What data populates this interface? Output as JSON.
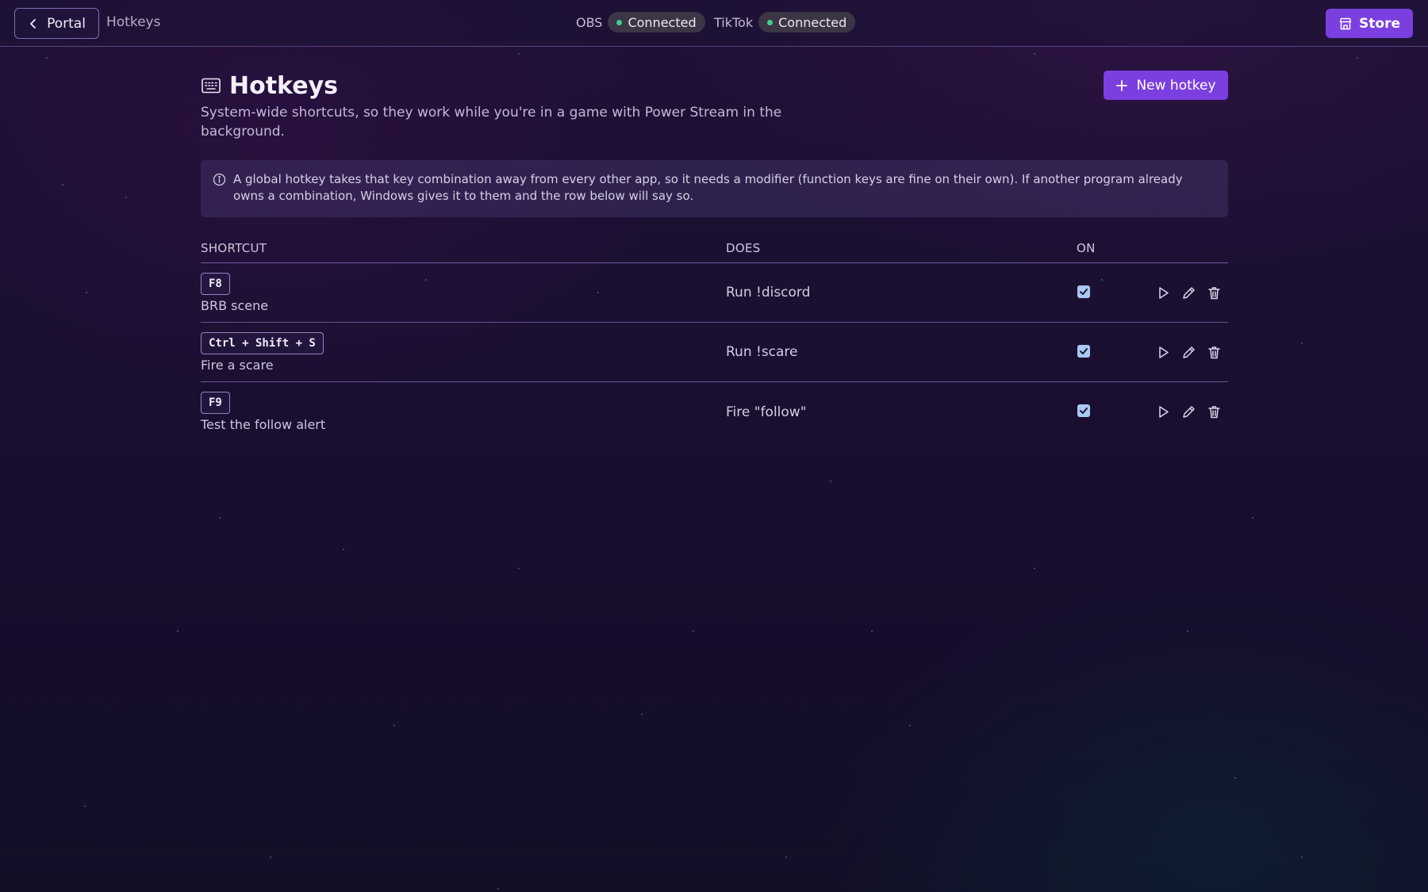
{
  "topbar": {
    "back_label": "Portal",
    "crumb": "Hotkeys",
    "obs_label": "OBS",
    "obs_status": "Connected",
    "tiktok_label": "TikTok",
    "tiktok_status": "Connected",
    "store_label": "Store"
  },
  "page": {
    "title": "Hotkeys",
    "subtitle": "System-wide shortcuts, so they work while you're in a game with Power Stream in the background.",
    "new_label": "New hotkey",
    "info": "A global hotkey takes that key combination away from every other app, so it needs a modifier (function keys are fine on their own). If another program already owns a combination, Windows gives it to them and the row below will say so."
  },
  "table": {
    "headers": {
      "shortcut": "SHORTCUT",
      "does": "DOES",
      "on": "ON"
    },
    "rows": [
      {
        "key": "F8",
        "name": "BRB scene",
        "does": "Run !discord",
        "on": true
      },
      {
        "key": "Ctrl + Shift + S",
        "name": "Fire a scare",
        "does": "Run !scare",
        "on": true
      },
      {
        "key": "F9",
        "name": "Test the follow alert",
        "does": "Fire \"follow\"",
        "on": true
      }
    ]
  },
  "colors": {
    "accent": "#7b3fe0",
    "status_dot": "#3ecf8e",
    "checkbox": "#a9c8f2"
  },
  "icons": [
    "chevron-left-icon",
    "store-icon",
    "keyboard-icon",
    "plus-icon",
    "info-icon",
    "check-icon",
    "play-icon",
    "pencil-icon",
    "trash-icon"
  ]
}
